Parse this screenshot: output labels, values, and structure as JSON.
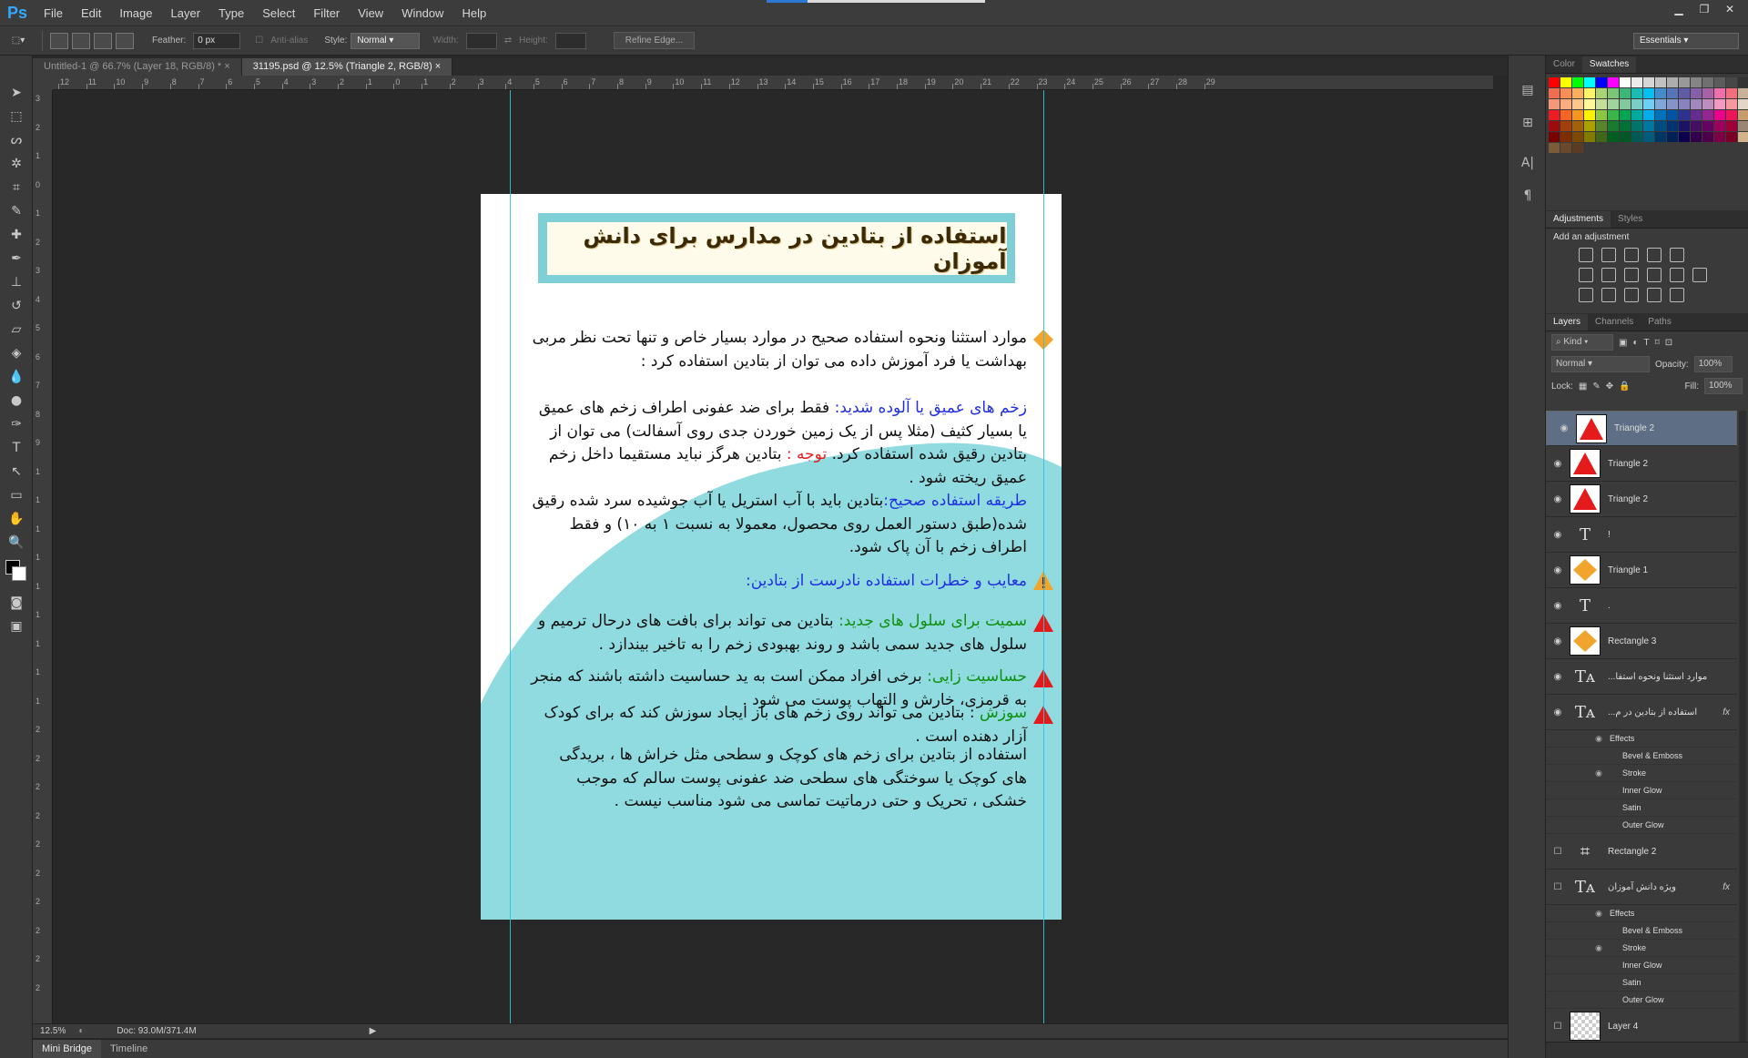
{
  "app": {
    "logo": "Ps"
  },
  "menu": [
    "File",
    "Edit",
    "Image",
    "Layer",
    "Type",
    "Select",
    "Filter",
    "View",
    "Window",
    "Help"
  ],
  "options": {
    "feather_label": "Feather:",
    "feather_value": "0 px",
    "antialias_label": "Anti-alias",
    "style_label": "Style:",
    "style_value": "Normal",
    "width_label": "Width:",
    "height_label": "Height:",
    "refine_edge": "Refine Edge...",
    "workspace": "Essentials"
  },
  "tabs": [
    {
      "label": "Untitled-1 @ 66.7% (Layer 18, RGB/8) *"
    },
    {
      "label": "31195.psd @ 12.5% (Triangle 2, RGB/8)"
    }
  ],
  "ruler_h": [
    "12",
    "11",
    "10",
    "9",
    "8",
    "7",
    "6",
    "5",
    "4",
    "3",
    "2",
    "1",
    "0",
    "1",
    "2",
    "3",
    "4",
    "5",
    "6",
    "7",
    "8",
    "9",
    "10",
    "11",
    "12",
    "13",
    "14",
    "15",
    "16",
    "17",
    "18",
    "19",
    "20",
    "21",
    "22",
    "23",
    "24",
    "25",
    "26",
    "27",
    "28",
    "29"
  ],
  "ruler_v": [
    "3",
    "2",
    "1",
    "0",
    "1",
    "2",
    "3",
    "4",
    "5",
    "6",
    "7",
    "8",
    "9",
    "1",
    "1",
    "1",
    "1",
    "1",
    "1",
    "1",
    "1",
    "1",
    "2",
    "2",
    "2",
    "2",
    "2",
    "2",
    "2",
    "2",
    "2",
    "2"
  ],
  "document": {
    "title": "استفاده از بتادین در مدارس برای دانش آموزان",
    "p1": "موارد استثنا ونحوه استفاده صحیح در موارد بسیار خاص و تنها تحت نظر مربی بهداشت یا فرد آموزش داده می توان از بتادین استفاده کرد :",
    "p2_head": "زخم های عمیق یا آلوده شدید:",
    "p2_body": " فقط برای ضد عفونی اطراف زخم های عمیق یا بسیار کثیف (مثلا پس از یک زمین خوردن جدی روی آسفالت) می توان از بتادین رقیق شده استفاده کرد.",
    "p2_warn": " توجه : ",
    "p2_tail": "بتادین هرگز نباید مستقیما داخل زخم عمیق ریخته شود .",
    "p3_head": "طریقه استفاده صحیح:",
    "p3_body": "بتادین باید با آب استریل یا آب جوشیده سرد شده رقیق شده(طبق دستور العمل روی محصول، معمولا به نسبت ۱ به ۱۰) و فقط اطراف زخم با آن پاک شود.",
    "p4": "معایب و خطرات استفاده نادرست از بتادین:",
    "p5_head": "سمیت برای سلول های جدید:",
    "p5_body": " بتادین می تواند برای بافت های درحال ترمیم و سلول های جدید سمی باشد و روند بهبودی زخم را به تاخیر بیندازد .",
    "p6_head": "حساسیت زایی:",
    "p6_body": " برخی افراد ممکن است به ید حساسیت داشته باشند که منجر به قرمزی، خارش و التهاب پوست می شود .",
    "p7_head": "سوزش",
    "p7_body": " : بتادین می تواند روی زخم های باز ایجاد سوزش کند که برای کودک آزار دهنده است .",
    "p8": "استفاده از بتادین برای زخم های کوچک و سطحی مثل خراش ها ، بریدگی های کوچک یا سوختگی های سطحی ضد عفونی پوست سالم که موجب خشکی ، تحریک و حتی درماتیت تماسی می شود مناسب نیست ."
  },
  "status": {
    "zoom": "12.5%",
    "doc": "Doc: 93.0M/371.4M"
  },
  "bottom_tabs": [
    "Mini Bridge",
    "Timeline"
  ],
  "panels": {
    "color_tabs": [
      "Color",
      "Swatches"
    ],
    "adj_tabs": [
      "Adjustments",
      "Styles"
    ],
    "adj_title": "Add an adjustment",
    "layer_tabs": [
      "Layers",
      "Channels",
      "Paths"
    ],
    "kind": "Kind",
    "blend": "Normal",
    "opacity_label": "Opacity:",
    "opacity": "100%",
    "lock_label": "Lock:",
    "fill_label": "Fill:",
    "fill": "100%"
  },
  "layers": [
    {
      "name": "Triangle 2",
      "type": "shape",
      "selected": true
    },
    {
      "name": "Triangle 2",
      "type": "shape"
    },
    {
      "name": "Triangle 2",
      "type": "shape"
    },
    {
      "name": "!",
      "type": "text"
    },
    {
      "name": "Triangle 1",
      "type": "shape-y"
    },
    {
      "name": ".",
      "type": "text"
    },
    {
      "name": "Rectangle 3",
      "type": "shape-y"
    },
    {
      "name": "...موارد استثنا ونحوه استفا",
      "type": "textA"
    },
    {
      "name": "...استفاده از بتادین در م",
      "type": "textA",
      "fx": "fx"
    },
    {
      "name": "Rectangle 2",
      "type": "rect"
    },
    {
      "name": "ویژه دانش آموزان",
      "type": "textA",
      "fx": "fx"
    },
    {
      "name": "Layer 4",
      "type": "pixel"
    }
  ],
  "effects": [
    "Effects",
    "Bevel & Emboss",
    "Stroke",
    "Inner Glow",
    "Satin",
    "Outer Glow"
  ]
}
